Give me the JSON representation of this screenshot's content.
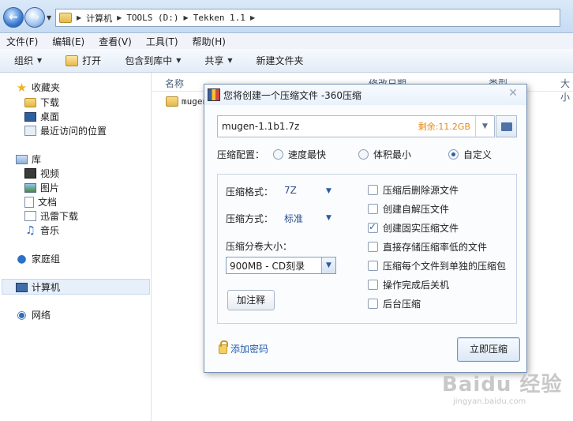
{
  "address": {
    "crumbs": [
      "计算机",
      "TOOLS (D:)",
      "Tekken 1.1"
    ]
  },
  "menubar": [
    "文件(F)",
    "编辑(E)",
    "查看(V)",
    "工具(T)",
    "帮助(H)"
  ],
  "toolbar": {
    "organize": "组织",
    "open": "打开",
    "include_in_library": "包含到库中",
    "share": "共享",
    "new_folder": "新建文件夹"
  },
  "navpane": {
    "favorites": "收藏夹",
    "downloads": "下载",
    "desktop": "桌面",
    "recent": "最近访问的位置",
    "libraries": "库",
    "videos": "视频",
    "pictures": "图片",
    "documents": "文档",
    "xunlei": "迅雷下载",
    "music": "音乐",
    "homegroup": "家庭组",
    "computer": "计算机",
    "network": "网络"
  },
  "filelist": {
    "columns": [
      "名称",
      "修改日期",
      "类型",
      "大小"
    ],
    "rows": [
      {
        "name": "mugen"
      }
    ]
  },
  "dialog": {
    "title": "您将创建一个压缩文件 -360压缩",
    "filename": "mugen-1.1b1.7z",
    "free_space": "剩余:11.2GB",
    "config_label": "压缩配置：",
    "radios": [
      "速度最快",
      "体积最小",
      "自定义"
    ],
    "selected_radio": "自定义",
    "format_label": "压缩格式：",
    "format_value": "7Z",
    "method_label": "压缩方式：",
    "method_value": "标准",
    "volume_label": "压缩分卷大小：",
    "volume_value": "900MB  - CD刻录",
    "add_note": "加注释",
    "options": [
      {
        "label": "压缩后删除源文件",
        "checked": false
      },
      {
        "label": "创建自解压文件",
        "checked": false
      },
      {
        "label": "创建固实压缩文件",
        "checked": true
      },
      {
        "label": "直接存储压缩率低的文件",
        "checked": false
      },
      {
        "label": "压缩每个文件到单独的压缩包",
        "checked": false
      },
      {
        "label": "操作完成后关机",
        "checked": false
      },
      {
        "label": "后台压缩",
        "checked": false
      }
    ],
    "add_password": "添加密码",
    "compress_now": "立即压缩"
  },
  "watermark": {
    "logo": "Baidu 经验",
    "url": "jingyan.baidu.com"
  }
}
